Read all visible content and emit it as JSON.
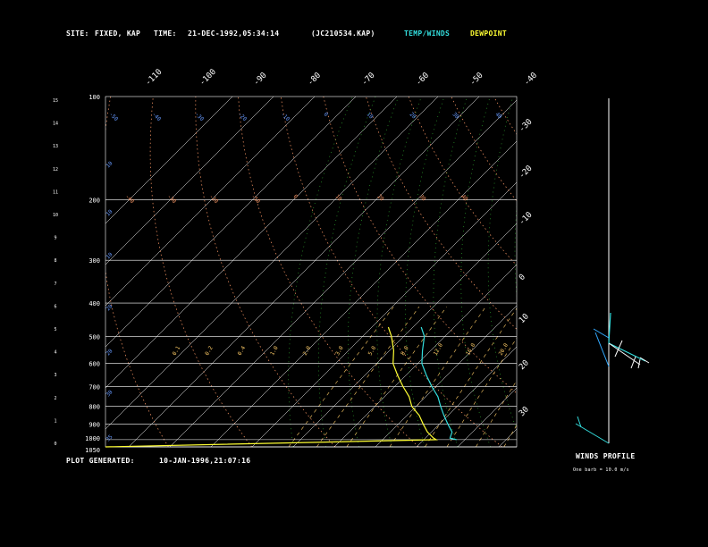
{
  "header": {
    "site_label": "SITE:",
    "site_value": "FIXED, KAP",
    "time_label": "TIME:",
    "time_value": "21-DEC-1992,05:34:14",
    "file": "(JC210534.KAP)",
    "legend_temp": "TEMP/WINDS",
    "legend_dew": "DEWPOINT"
  },
  "footer": {
    "generated_label": "PLOT GENERATED:",
    "generated_value": "10-JAN-1996,21:07:16",
    "winds_title": "WINDS PROFILE",
    "barb_note": "One barb = 10.0 m/s"
  },
  "colors": {
    "background": "#000000",
    "temp": "#33dddd",
    "dewpoint": "#ffff33",
    "dry_adiabat": "#ff9966",
    "moist_adiabat": "#33bb33",
    "mixing_ratio": "#ffcc66",
    "isobar": "#ffffff",
    "label_blue": "#6699ff"
  },
  "chart_data": {
    "type": "skew-t",
    "pressure_ticks": [
      "100",
      "200",
      "300",
      "400",
      "500",
      "600",
      "700",
      "800",
      "900",
      "1000",
      "1050"
    ],
    "height_ticks": [
      "0",
      "1",
      "2",
      "3",
      "4",
      "5",
      "6",
      "7",
      "8",
      "9",
      "10",
      "11",
      "12",
      "13",
      "14",
      "15"
    ],
    "isotherm_top_labels": [
      "-110",
      "-100",
      "-90",
      "-80",
      "-70",
      "-60",
      "-50",
      "-40"
    ],
    "isotherm_right_labels": [
      "-30",
      "-20",
      "-10",
      "0",
      "10",
      "20",
      "30"
    ],
    "left_edge_labels": [
      "10",
      "10",
      "10",
      "20",
      "20",
      "30",
      "35"
    ],
    "dry_adiabat_labels": [
      "-40",
      "-30",
      "-20",
      "-10",
      "0",
      "10",
      "20",
      "30",
      "40"
    ],
    "dry_adiabat_top_labels": [
      "-50",
      "-40",
      "-30",
      "-20",
      "-10",
      "0",
      "10",
      "20",
      "30",
      "40"
    ],
    "mixing_ratio_labels": [
      "0.1",
      "0.2",
      "0.4",
      "1.0",
      "2.0",
      "3.0",
      "5.0",
      "8.0",
      "12.0",
      "16.0",
      "20.0"
    ],
    "temperature_profile": [
      {
        "p": 1000,
        "t": -2
      },
      {
        "p": 990,
        "t": -4
      },
      {
        "p": 950,
        "t": -5
      },
      {
        "p": 900,
        "t": -8
      },
      {
        "p": 850,
        "t": -11
      },
      {
        "p": 800,
        "t": -14
      },
      {
        "p": 750,
        "t": -17
      },
      {
        "p": 700,
        "t": -21
      },
      {
        "p": 650,
        "t": -25
      },
      {
        "p": 600,
        "t": -29
      },
      {
        "p": 550,
        "t": -32
      },
      {
        "p": 500,
        "t": -35
      },
      {
        "p": 470,
        "t": -38
      }
    ],
    "dewpoint_profile": [
      {
        "p": 1050,
        "td": -95
      },
      {
        "p": 1000,
        "td": -7
      },
      {
        "p": 990,
        "td": -8
      },
      {
        "p": 950,
        "td": -11
      },
      {
        "p": 900,
        "td": -14
      },
      {
        "p": 850,
        "td": -17
      },
      {
        "p": 800,
        "td": -21
      },
      {
        "p": 750,
        "td": -24
      },
      {
        "p": 700,
        "td": -28
      },
      {
        "p": 650,
        "td": -32
      },
      {
        "p": 600,
        "td": -36
      },
      {
        "p": 550,
        "td": -39
      },
      {
        "p": 500,
        "td": -43
      },
      {
        "p": 470,
        "td": -46
      }
    ]
  }
}
